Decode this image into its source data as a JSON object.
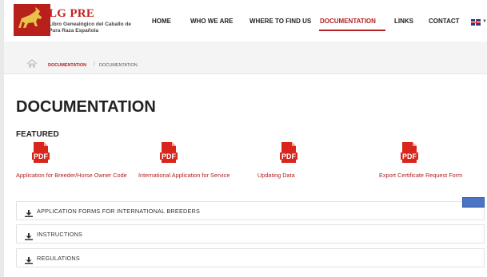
{
  "brand": {
    "name": "LG PRE",
    "subtitle": "Libro Genealógico del Caballo de Pura Raza Española"
  },
  "nav": {
    "items": [
      {
        "label": "HOME"
      },
      {
        "label": "WHO WE ARE"
      },
      {
        "label": "WHERE TO FIND US"
      },
      {
        "label": "DOCUMENTATION"
      },
      {
        "label": "LINKS"
      },
      {
        "label": "CONTACT"
      }
    ],
    "active": "DOCUMENTATION",
    "language_icon": "uk-flag-icon"
  },
  "breadcrumb": {
    "home_icon": "home-icon",
    "link": "DOCUMENTATION",
    "separator": "/",
    "current": "DOCUMENTATION"
  },
  "page": {
    "title": "DOCUMENTATION",
    "featured_heading": "FEATURED"
  },
  "featured_docs": [
    {
      "icon": "pdf-icon",
      "label": "Application for Breeder/Horse Owner Code"
    },
    {
      "icon": "pdf-icon",
      "label": "International Application for Service"
    },
    {
      "icon": "pdf-icon",
      "label": "Updating Data"
    },
    {
      "icon": "pdf-icon",
      "label": "Export Certificate Request Form"
    }
  ],
  "sections": [
    {
      "icon": "download-icon",
      "label": "APPLICATION FORMS FOR INTERNATIONAL BREEDERS"
    },
    {
      "icon": "download-icon",
      "label": "INSTRUCTIONS"
    },
    {
      "icon": "download-icon",
      "label": "REGULATIONS"
    }
  ],
  "colors": {
    "accent": "#b32020",
    "logo_red": "#c4211d",
    "button_blue": "#4a74c4"
  }
}
